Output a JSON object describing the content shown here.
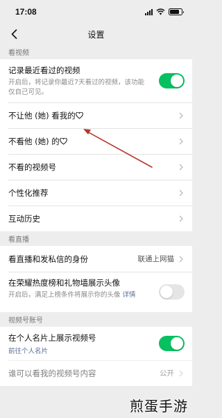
{
  "status_bar": {
    "time": "17:08"
  },
  "nav": {
    "title": "设置"
  },
  "sections": {
    "watch_video": {
      "header": "看视频",
      "record": {
        "title": "记录最近看过的视频",
        "desc": "开启后，将记录你最近7天看过的视频，该功能仅自己可见。",
        "enabled": true
      },
      "block_them": {
        "title": "不让他 (她) 看我的"
      },
      "not_watch": {
        "title": "不看他 (她) 的"
      },
      "not_channel": {
        "title": "不看的视频号"
      },
      "personalized": {
        "title": "个性化推荐"
      },
      "history": {
        "title": "互动历史"
      }
    },
    "live": {
      "header": "看直播",
      "identity": {
        "title": "看直播和发私信的身份",
        "value": "联通上网猫"
      },
      "honor": {
        "title": "在荣耀热度榜和礼物墙展示头像",
        "desc": "开启后，满足上榜条件将展示你的头像",
        "link": "详情",
        "enabled": false
      }
    },
    "channel_account": {
      "header": "视频号账号",
      "show_card": {
        "title": "在个人名片上展示视频号",
        "link": "前往个人名片",
        "enabled": true
      },
      "who_can_see": {
        "title": "谁可以看我的视频号内容",
        "value": "公开"
      }
    }
  },
  "watermark": {
    "text": "煎蛋手游"
  },
  "colors": {
    "accent_green": "#07c160",
    "link_blue": "#576b95",
    "annotation_red": "#b5362b"
  }
}
